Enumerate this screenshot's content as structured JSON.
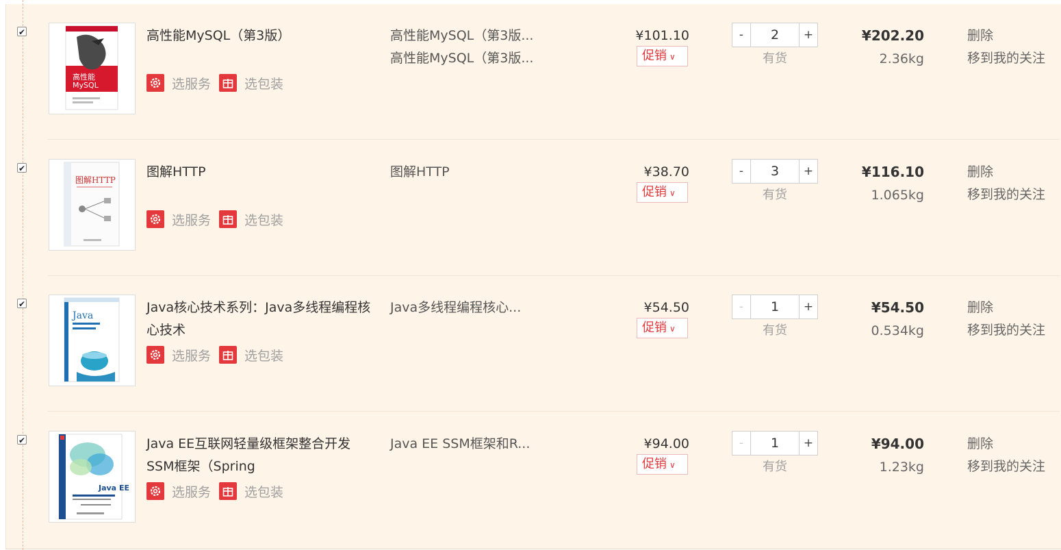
{
  "colors": {
    "accent": "#e4393c",
    "panel_bg": "#fff4e8",
    "muted": "#a0a0a0"
  },
  "icons": {
    "service": "gear-badge-icon",
    "package": "gift-box-icon",
    "promo_chevron": "chevron-down-icon"
  },
  "items": [
    {
      "checked": true,
      "title": "高性能MySQL（第3版）",
      "props": [
        "高性能MySQL（第3版...",
        "高性能MySQL（第3版..."
      ],
      "service_label": "选服务",
      "package_label": "选包装",
      "price": "¥101.10",
      "promo_label": "促销",
      "qty_minus": "-",
      "qty": "2",
      "qty_plus": "+",
      "stock": "有货",
      "subtotal": "¥202.20",
      "weight": "2.36kg",
      "delete_label": "删除",
      "follow_label": "移到我的关注"
    },
    {
      "checked": true,
      "title": "图解HTTP",
      "props": [
        "图解HTTP"
      ],
      "service_label": "选服务",
      "package_label": "选包装",
      "price": "¥38.70",
      "promo_label": "促销",
      "qty_minus": "-",
      "qty": "3",
      "qty_plus": "+",
      "stock": "有货",
      "subtotal": "¥116.10",
      "weight": "1.065kg",
      "delete_label": "删除",
      "follow_label": "移到我的关注"
    },
    {
      "checked": true,
      "title": "Java核心技术系列：Java多线程编程核心技术",
      "props": [
        "Java多线程编程核心..."
      ],
      "service_label": "选服务",
      "package_label": "选包装",
      "price": "¥54.50",
      "promo_label": "促销",
      "qty_minus": "-",
      "qty": "1",
      "qty_plus": "+",
      "stock": "有货",
      "subtotal": "¥54.50",
      "weight": "0.534kg",
      "delete_label": "删除",
      "follow_label": "移到我的关注"
    },
    {
      "checked": true,
      "title": "Java EE互联网轻量级框架整合开发 SSM框架（Spring",
      "props": [
        "Java EE SSM框架和R..."
      ],
      "service_label": "选服务",
      "package_label": "选包装",
      "price": "¥94.00",
      "promo_label": "促销",
      "qty_minus": "-",
      "qty": "1",
      "qty_plus": "+",
      "stock": "有货",
      "subtotal": "¥94.00",
      "weight": "1.23kg",
      "delete_label": "删除",
      "follow_label": "移到我的关注"
    }
  ]
}
